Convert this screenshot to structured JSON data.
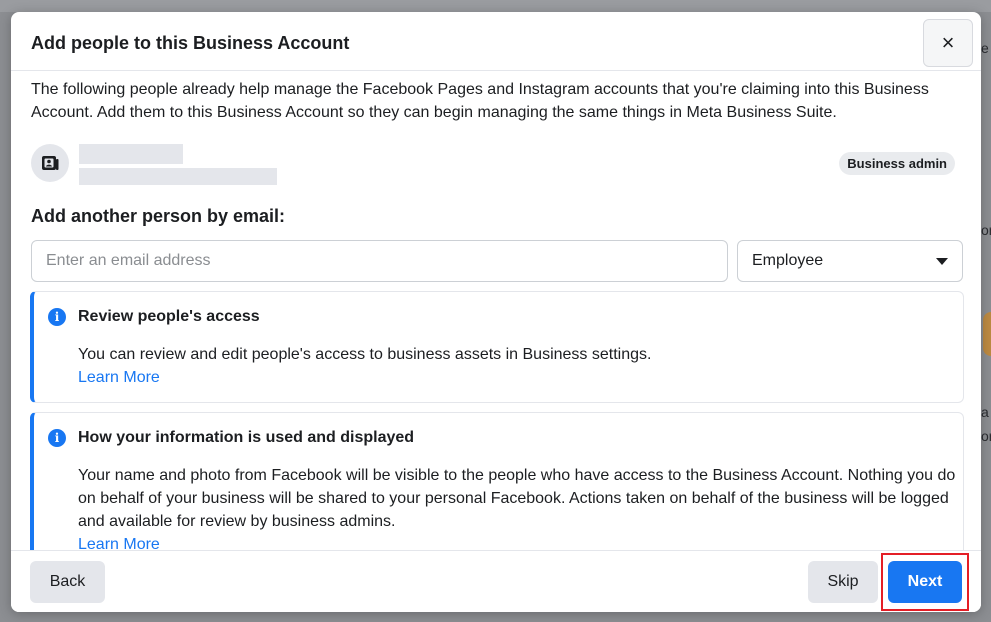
{
  "dialog": {
    "title": "Add people to this Business Account",
    "close_label": "×",
    "intro": "The following people already help manage the Facebook Pages and Instagram accounts that you're claiming into this Business Account. Add them to this Business Account so they can begin managing the same things in Meta Business Suite."
  },
  "existing_person": {
    "role": "Business admin"
  },
  "add_by_email": {
    "label": "Add another person by email:",
    "placeholder": "Enter an email address",
    "role_selected": "Employee"
  },
  "info_cards": [
    {
      "title": "Review people's access",
      "body": "You can review and edit people's access to business assets in Business settings.",
      "link": "Learn More"
    },
    {
      "title": "How your information is used and displayed",
      "body": "Your name and photo from Facebook will be visible to the people who have access to the Business Account. Nothing you do on behalf of your business will be shared to your personal Facebook. Actions taken on behalf of the business will be logged and available for review by business admins.",
      "link": "Learn More"
    }
  ],
  "footer": {
    "back_label": "Back",
    "skip_label": "Skip",
    "next_label": "Next"
  },
  "colors": {
    "accent": "#1877f2",
    "highlight": "#e41e26"
  }
}
